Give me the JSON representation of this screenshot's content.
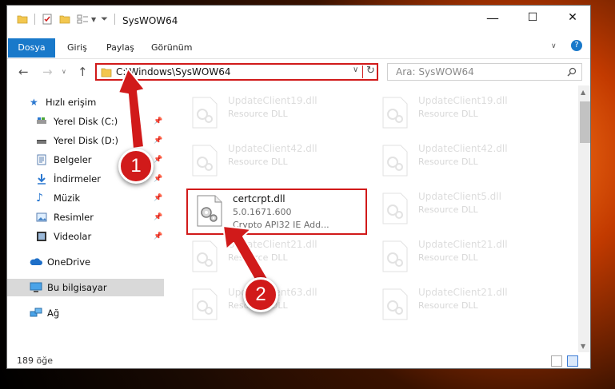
{
  "window": {
    "title": "SysWOW64",
    "controls": {
      "minimize": "—",
      "maximize": "☐",
      "close": "✕"
    }
  },
  "ribbon": {
    "tabs": [
      "Dosya",
      "Giriş",
      "Paylaş",
      "Görünüm"
    ]
  },
  "navigation": {
    "address": "C:\\Windows\\SysWOW64",
    "search_placeholder": "Ara: SysWOW64"
  },
  "sidebar": {
    "items": [
      {
        "label": "Hızlı erişim",
        "icon": "star-icon"
      },
      {
        "label": "Yerel Disk (C:)",
        "icon": "drive-icon",
        "pinned": true
      },
      {
        "label": "Yerel Disk (D:)",
        "icon": "drive-icon",
        "pinned": true
      },
      {
        "label": "Belgeler",
        "icon": "documents-icon",
        "pinned": true
      },
      {
        "label": "İndirmeler",
        "icon": "download-icon",
        "pinned": true
      },
      {
        "label": "Müzik",
        "icon": "music-icon",
        "pinned": true
      },
      {
        "label": "Resimler",
        "icon": "pictures-icon",
        "pinned": true
      },
      {
        "label": "Videolar",
        "icon": "videos-icon",
        "pinned": true
      },
      {
        "label": "OneDrive",
        "icon": "cloud-icon"
      },
      {
        "label": "Bu bilgisayar",
        "icon": "computer-icon",
        "selected": true
      },
      {
        "label": "Ağ",
        "icon": "network-icon"
      }
    ]
  },
  "files": {
    "faded": [
      {
        "name": "UpdateClient19.dll",
        "type": "Resource DLL"
      },
      {
        "name": "UpdateClient19.dll",
        "type": "Resource DLL"
      },
      {
        "name": "UpdateClient42.dll",
        "type": "Resource DLL"
      },
      {
        "name": "UpdateClient42.dll",
        "type": "Resource DLL"
      },
      {
        "name": "UpdateClient5.dll",
        "type": "Resource DLL"
      },
      {
        "name": "UpdateClient21.dll",
        "type": "Resource DLL"
      },
      {
        "name": "UpdateClient21.dll",
        "type": "Resource DLL"
      },
      {
        "name": "UpdateClient63.dll",
        "type": "Resource DLL"
      },
      {
        "name": "UpdateClient21.dll",
        "type": "Resource DLL"
      }
    ],
    "highlighted": {
      "name": "certcrpt.dll",
      "version": "5.0.1671.600",
      "description": "Crypto API32 IE Add..."
    }
  },
  "status": {
    "item_count": "189 öğe"
  },
  "annotations": {
    "step1": "1",
    "step2": "2",
    "color": "#d11a1a"
  }
}
